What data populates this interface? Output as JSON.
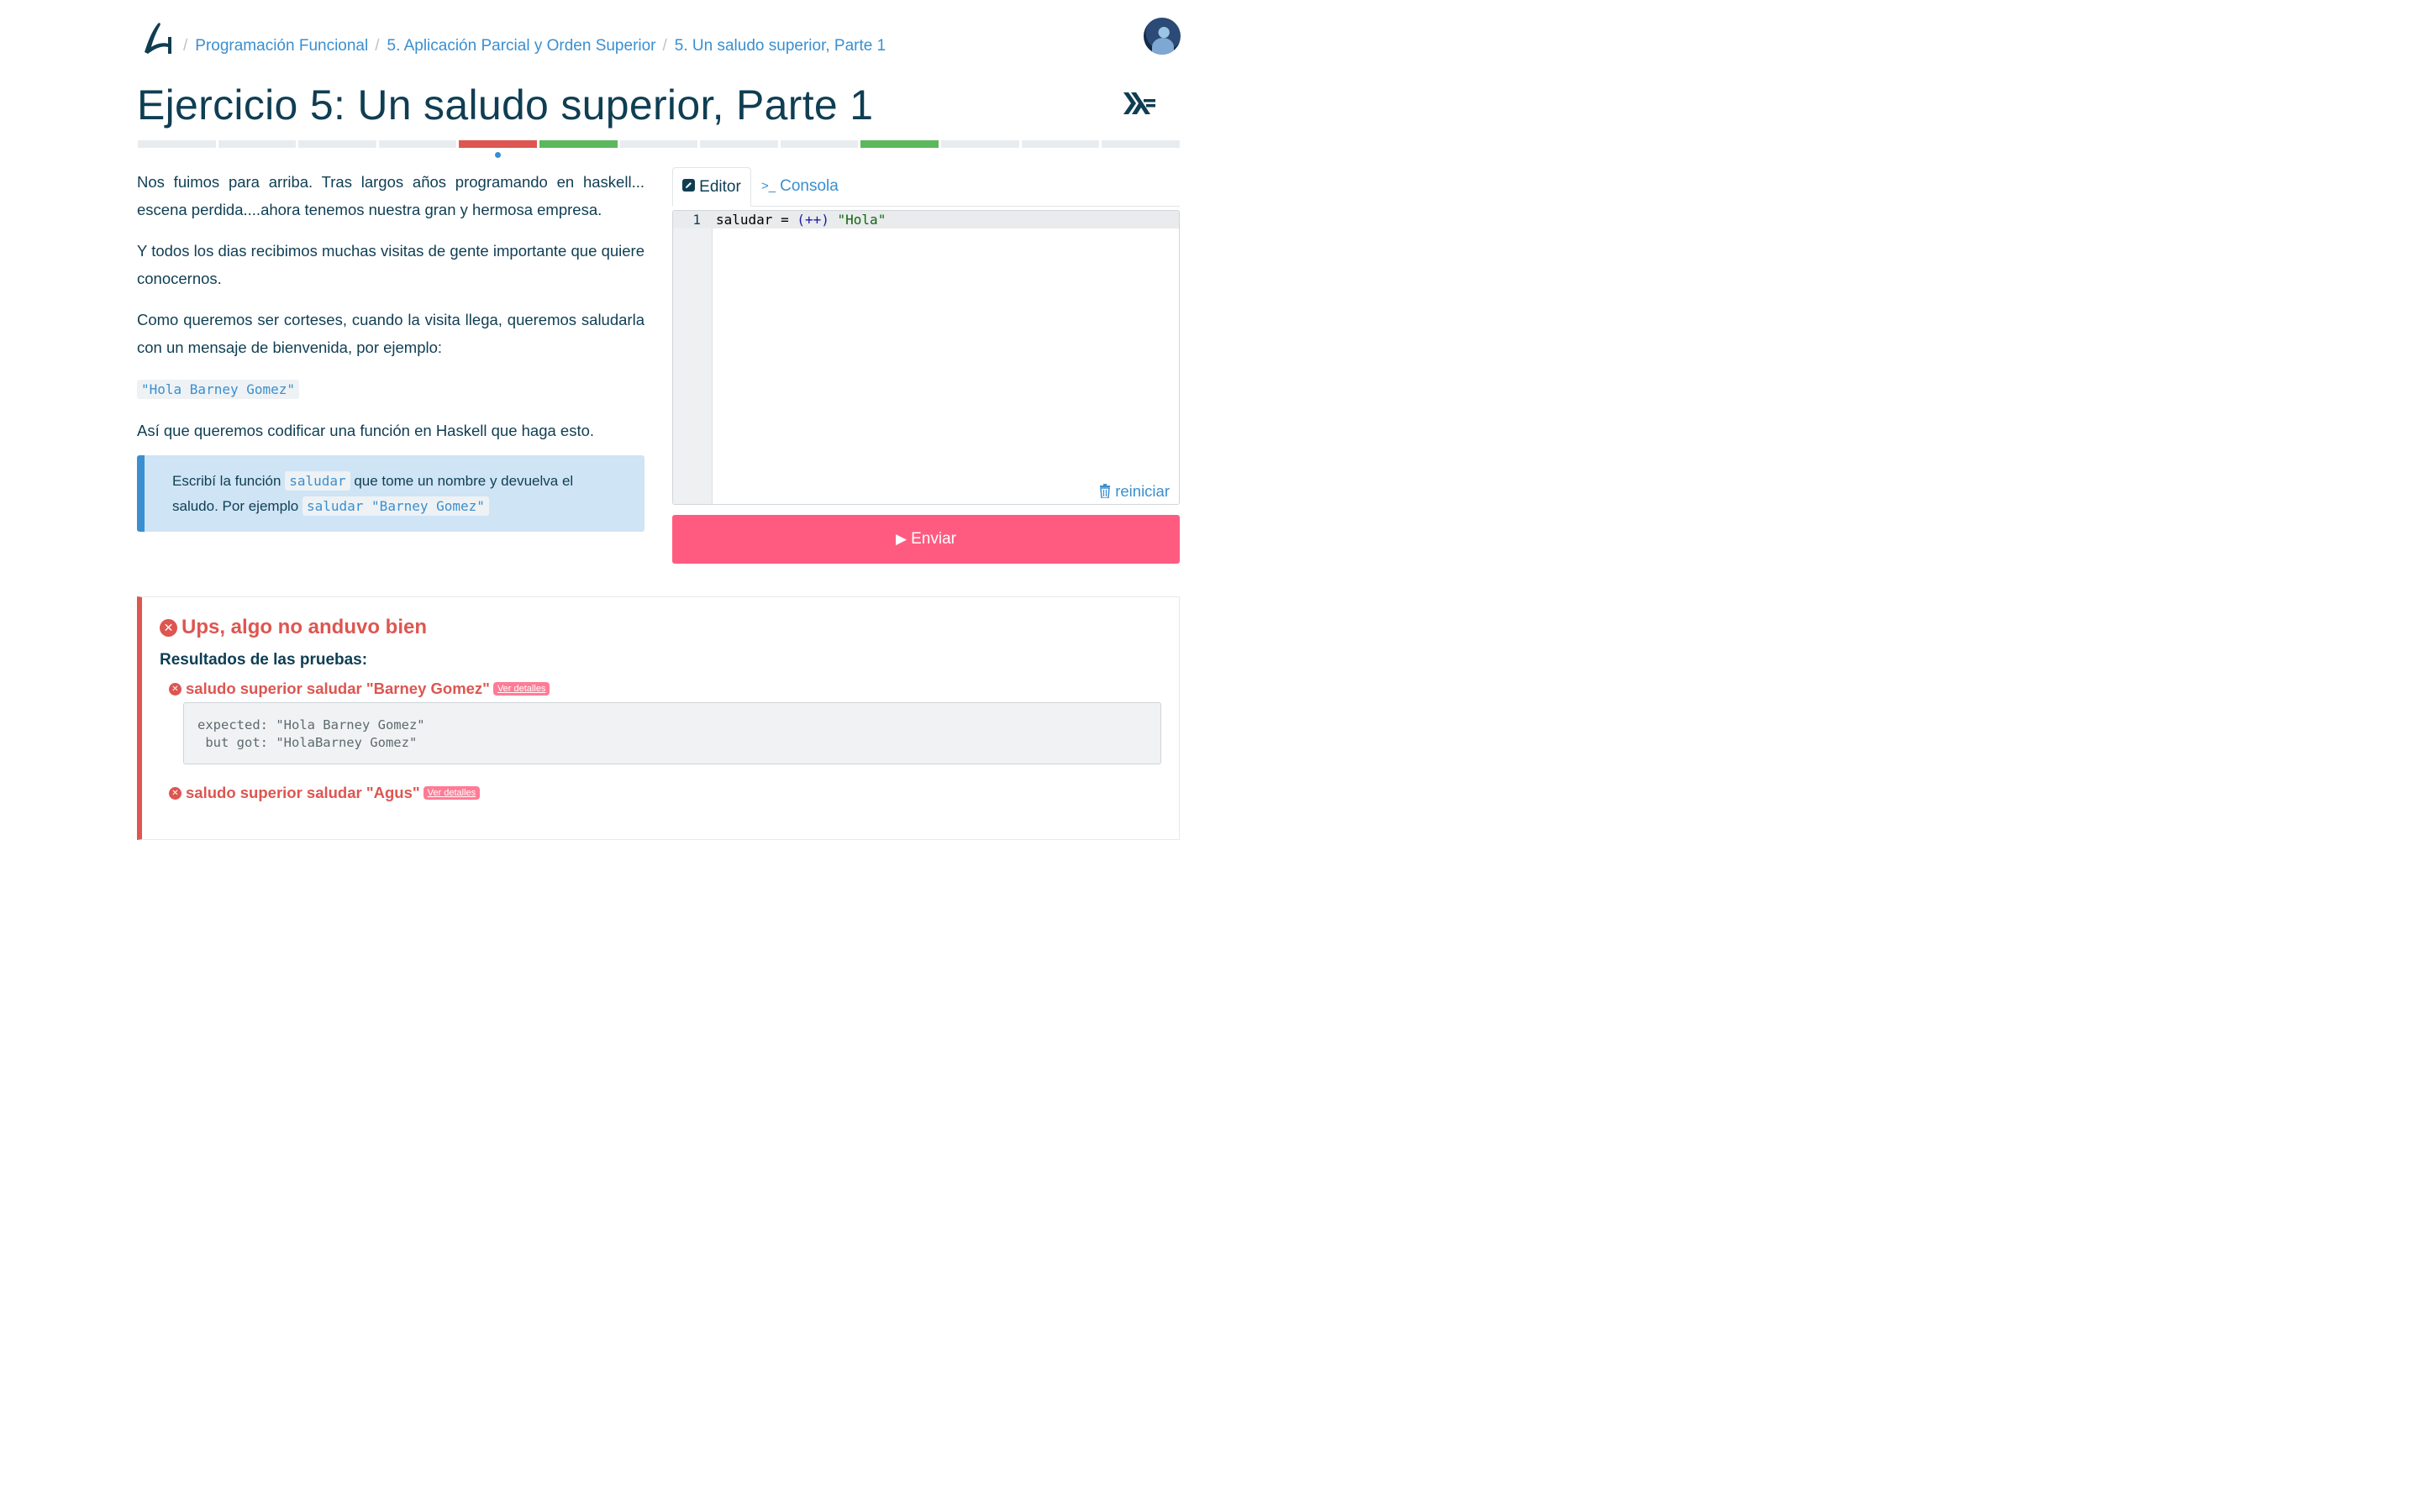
{
  "breadcrumb": {
    "items": [
      "Programación Funcional",
      "5. Aplicación Parcial y Orden Superior",
      "5. Un saludo superior, Parte 1"
    ]
  },
  "exercise": {
    "title": "Ejercicio 5: Un saludo superior, Parte 1",
    "language_icon": "haskell-icon"
  },
  "progress": {
    "segments": [
      "none",
      "none",
      "none",
      "none",
      "fail",
      "pass",
      "none",
      "none",
      "none",
      "pass",
      "none",
      "none",
      "none"
    ],
    "current_index": 4
  },
  "description": {
    "p1": "Nos fuimos para arriba. Tras largos años programando en haskell... escena perdida....ahora tenemos nuestra gran y hermosa empresa.",
    "p2": "Y todos los dias recibimos muchas visitas de gente importante que quiere conocernos.",
    "p3": "Como queremos ser corteses, cuando la visita llega, queremos saludarla con un mensaje de bienvenida, por ejemplo:",
    "code_example": "\"Hola Barney Gomez\"",
    "p4": "Así que queremos codificar una función en Haskell que haga esto."
  },
  "assignment": {
    "text1": "Escribí la función ",
    "code1": "saludar",
    "text2": " que tome un nombre y devuelva el saludo. Por ejemplo ",
    "code2": "saludar \"Barney Gomez\""
  },
  "editor": {
    "tab_editor": "Editor",
    "tab_console": "Consola",
    "line_number": "1",
    "code": {
      "ident": "saludar",
      "eq": " = ",
      "paren_open": "(",
      "op": "++",
      "paren_close": ")",
      "string": " \"Hola\""
    },
    "reset_label": "reiniciar"
  },
  "submit": {
    "label": "Enviar"
  },
  "results": {
    "title": "Ups, algo no anduvo bien",
    "subtitle": "Resultados de las pruebas:",
    "details_label": "Ver detalles",
    "tests": [
      {
        "name": "saludo superior saludar \"Barney Gomez\"",
        "status": "fail",
        "output": "expected: \"Hola Barney Gomez\"\n but got: \"HolaBarney Gomez\""
      },
      {
        "name": "saludo superior saludar \"Agus\"",
        "status": "fail"
      }
    ]
  },
  "colors": {
    "accent": "#3a8fd0",
    "danger": "#dd5651",
    "success": "#5cb85c",
    "submit": "#ff5b81",
    "text": "#0f3e53"
  }
}
